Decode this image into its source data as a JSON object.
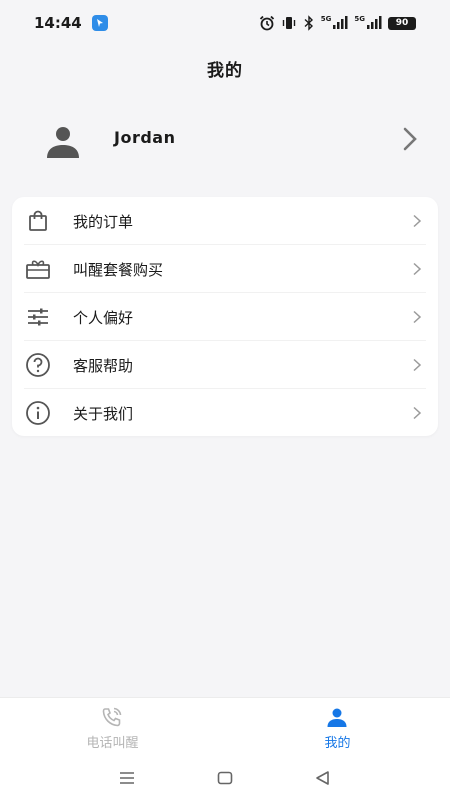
{
  "status_bar": {
    "time": "14:44",
    "battery": "90",
    "signal1_label": "5G",
    "signal2_label": "5G"
  },
  "header": {
    "title": "我的"
  },
  "profile": {
    "name": "Jordan",
    "avatar_icon": "person-icon",
    "chevron_icon": "chevron-right-icon"
  },
  "menu": {
    "items": [
      {
        "label": "我的订单",
        "icon": "shopping-bag-icon"
      },
      {
        "label": "叫醒套餐购买",
        "icon": "gift-box-icon"
      },
      {
        "label": "个人偏好",
        "icon": "sliders-icon"
      },
      {
        "label": "客服帮助",
        "icon": "help-circle-icon"
      },
      {
        "label": "关于我们",
        "icon": "info-circle-icon"
      }
    ]
  },
  "tab_bar": {
    "tabs": [
      {
        "label": "电话叫醒",
        "icon": "phone-call-icon",
        "active": false
      },
      {
        "label": "我的",
        "icon": "person-icon",
        "active": true
      }
    ]
  },
  "colors": {
    "accent": "#1677e6",
    "inactive": "#b5b5b5",
    "background": "#f5f5f7",
    "card": "#ffffff",
    "icon_gray": "#555555"
  },
  "system_nav": {
    "buttons": [
      "menu-icon",
      "home-icon",
      "back-icon"
    ]
  }
}
